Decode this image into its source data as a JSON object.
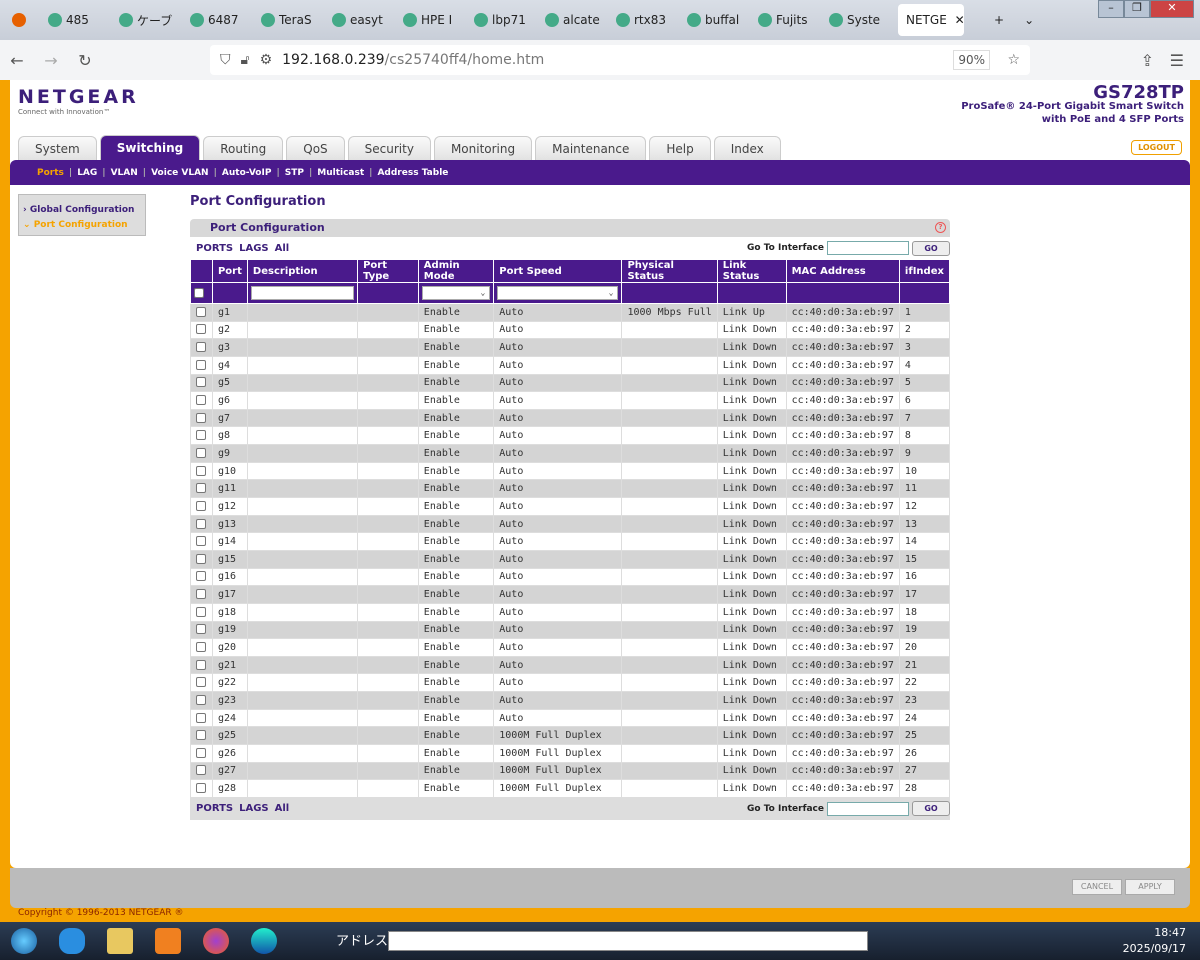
{
  "browser": {
    "tabs": [
      "485",
      "ケーブ",
      "6487",
      "TeraS",
      "easyt",
      "HPE I",
      "lbp71",
      "alcate",
      "rtx83",
      "buffal",
      "Fujits",
      "Syste"
    ],
    "active_tab": "NETGE",
    "url_host": "192.168.0.239",
    "url_path": "/cs25740ff4/home.htm",
    "zoom": "90%"
  },
  "header": {
    "logo": "NETGEAR",
    "tagline": "Connect with Innovation™",
    "model": "GS728TP",
    "model_desc1": "ProSafe® 24-Port Gigabit Smart Switch",
    "model_desc2": "with PoE and 4 SFP Ports",
    "logout": "LOGOUT"
  },
  "tabs": [
    "System",
    "Switching",
    "Routing",
    "QoS",
    "Security",
    "Monitoring",
    "Maintenance",
    "Help",
    "Index"
  ],
  "subnav": [
    "Ports",
    "LAG",
    "VLAN",
    "Voice VLAN",
    "Auto-VoIP",
    "STP",
    "Multicast",
    "Address Table"
  ],
  "sidebar": {
    "item1": "Global Configuration",
    "item2": "Port Configuration"
  },
  "page_title": "Port Configuration",
  "panel_title": "Port Configuration",
  "filter": {
    "ports": "PORTS",
    "lags": "LAGS",
    "all": "All",
    "goto": "Go To Interface",
    "go": "GO"
  },
  "columns": [
    "Port",
    "Description",
    "Port Type",
    "Admin Mode",
    "Port Speed",
    "Physical Status",
    "Link Status",
    "MAC Address",
    "ifIndex"
  ],
  "rows": [
    [
      "g1",
      "",
      "",
      "Enable",
      "Auto",
      "1000 Mbps Full",
      "Link Up",
      "cc:40:d0:3a:eb:97",
      "1"
    ],
    [
      "g2",
      "",
      "",
      "Enable",
      "Auto",
      "",
      "Link Down",
      "cc:40:d0:3a:eb:97",
      "2"
    ],
    [
      "g3",
      "",
      "",
      "Enable",
      "Auto",
      "",
      "Link Down",
      "cc:40:d0:3a:eb:97",
      "3"
    ],
    [
      "g4",
      "",
      "",
      "Enable",
      "Auto",
      "",
      "Link Down",
      "cc:40:d0:3a:eb:97",
      "4"
    ],
    [
      "g5",
      "",
      "",
      "Enable",
      "Auto",
      "",
      "Link Down",
      "cc:40:d0:3a:eb:97",
      "5"
    ],
    [
      "g6",
      "",
      "",
      "Enable",
      "Auto",
      "",
      "Link Down",
      "cc:40:d0:3a:eb:97",
      "6"
    ],
    [
      "g7",
      "",
      "",
      "Enable",
      "Auto",
      "",
      "Link Down",
      "cc:40:d0:3a:eb:97",
      "7"
    ],
    [
      "g8",
      "",
      "",
      "Enable",
      "Auto",
      "",
      "Link Down",
      "cc:40:d0:3a:eb:97",
      "8"
    ],
    [
      "g9",
      "",
      "",
      "Enable",
      "Auto",
      "",
      "Link Down",
      "cc:40:d0:3a:eb:97",
      "9"
    ],
    [
      "g10",
      "",
      "",
      "Enable",
      "Auto",
      "",
      "Link Down",
      "cc:40:d0:3a:eb:97",
      "10"
    ],
    [
      "g11",
      "",
      "",
      "Enable",
      "Auto",
      "",
      "Link Down",
      "cc:40:d0:3a:eb:97",
      "11"
    ],
    [
      "g12",
      "",
      "",
      "Enable",
      "Auto",
      "",
      "Link Down",
      "cc:40:d0:3a:eb:97",
      "12"
    ],
    [
      "g13",
      "",
      "",
      "Enable",
      "Auto",
      "",
      "Link Down",
      "cc:40:d0:3a:eb:97",
      "13"
    ],
    [
      "g14",
      "",
      "",
      "Enable",
      "Auto",
      "",
      "Link Down",
      "cc:40:d0:3a:eb:97",
      "14"
    ],
    [
      "g15",
      "",
      "",
      "Enable",
      "Auto",
      "",
      "Link Down",
      "cc:40:d0:3a:eb:97",
      "15"
    ],
    [
      "g16",
      "",
      "",
      "Enable",
      "Auto",
      "",
      "Link Down",
      "cc:40:d0:3a:eb:97",
      "16"
    ],
    [
      "g17",
      "",
      "",
      "Enable",
      "Auto",
      "",
      "Link Down",
      "cc:40:d0:3a:eb:97",
      "17"
    ],
    [
      "g18",
      "",
      "",
      "Enable",
      "Auto",
      "",
      "Link Down",
      "cc:40:d0:3a:eb:97",
      "18"
    ],
    [
      "g19",
      "",
      "",
      "Enable",
      "Auto",
      "",
      "Link Down",
      "cc:40:d0:3a:eb:97",
      "19"
    ],
    [
      "g20",
      "",
      "",
      "Enable",
      "Auto",
      "",
      "Link Down",
      "cc:40:d0:3a:eb:97",
      "20"
    ],
    [
      "g21",
      "",
      "",
      "Enable",
      "Auto",
      "",
      "Link Down",
      "cc:40:d0:3a:eb:97",
      "21"
    ],
    [
      "g22",
      "",
      "",
      "Enable",
      "Auto",
      "",
      "Link Down",
      "cc:40:d0:3a:eb:97",
      "22"
    ],
    [
      "g23",
      "",
      "",
      "Enable",
      "Auto",
      "",
      "Link Down",
      "cc:40:d0:3a:eb:97",
      "23"
    ],
    [
      "g24",
      "",
      "",
      "Enable",
      "Auto",
      "",
      "Link Down",
      "cc:40:d0:3a:eb:97",
      "24"
    ],
    [
      "g25",
      "",
      "",
      "Enable",
      "1000M Full Duplex",
      "",
      "Link Down",
      "cc:40:d0:3a:eb:97",
      "25"
    ],
    [
      "g26",
      "",
      "",
      "Enable",
      "1000M Full Duplex",
      "",
      "Link Down",
      "cc:40:d0:3a:eb:97",
      "26"
    ],
    [
      "g27",
      "",
      "",
      "Enable",
      "1000M Full Duplex",
      "",
      "Link Down",
      "cc:40:d0:3a:eb:97",
      "27"
    ],
    [
      "g28",
      "",
      "",
      "Enable",
      "1000M Full Duplex",
      "",
      "Link Down",
      "cc:40:d0:3a:eb:97",
      "28"
    ]
  ],
  "buttons": {
    "cancel": "CANCEL",
    "apply": "APPLY"
  },
  "copyright": "Copyright © 1996-2013 NETGEAR ®",
  "taskbar": {
    "address_label": "アドレス",
    "time": "18:47",
    "date": "2025/09/17"
  }
}
